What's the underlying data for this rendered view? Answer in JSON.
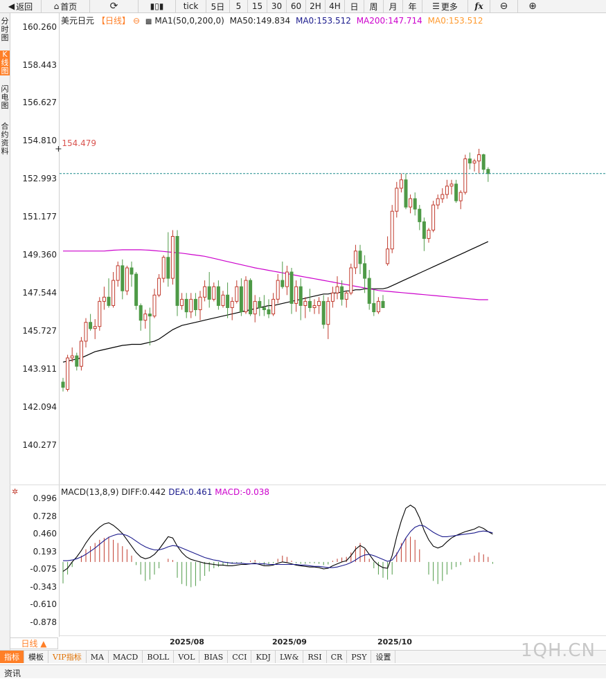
{
  "toolbar": {
    "back": "返回",
    "home": "首页",
    "tick": "tick",
    "periods": [
      "5日",
      "5",
      "15",
      "30",
      "60",
      "2H",
      "4H",
      "日",
      "周",
      "月",
      "年"
    ],
    "more": "更多",
    "fx": "fx"
  },
  "sidebar": {
    "items": [
      "分时图",
      "K线图",
      "闪电图",
      "合约资料"
    ],
    "active": "K线图"
  },
  "main_legend": {
    "symbol": "美元日元",
    "period": "【日线】",
    "ma_settings": "MA1(50,0,200,0)",
    "ma50": "MA50:149.834",
    "ma0a": "MA0:153.512",
    "ma200": "MA200:147.714",
    "ma0b": "MA0:153.512"
  },
  "macd_legend": {
    "name": "MACD(13,8,9)",
    "diff": "DIFF:0.442",
    "dea": "DEA:0.461",
    "macd": "MACD:-0.038"
  },
  "price_axis": [
    "160.260",
    "158.443",
    "156.627",
    "154.810",
    "152.993",
    "151.177",
    "149.360",
    "147.544",
    "145.727",
    "143.911",
    "142.094",
    "140.277"
  ],
  "macd_axis": [
    "0.996",
    "0.728",
    "0.460",
    "0.193",
    "-0.075",
    "-0.343",
    "-0.610",
    "-0.878"
  ],
  "date_labels": [
    "2025/08",
    "2025/09",
    "2025/10"
  ],
  "high_marker": "154.479",
  "period_tab": "日线 ▲",
  "indicator_tabs": [
    "指标",
    "模板",
    "VIP指标",
    "MA",
    "MACD",
    "BOLL",
    "VOL",
    "BIAS",
    "CCI",
    "KDJ",
    "LW&",
    "RSI",
    "CR",
    "PSY",
    "设置"
  ],
  "info_tab": "资讯",
  "watermark": "1QH.CN",
  "colors": {
    "up": "#c0392b",
    "down": "#4e9a47",
    "ma50": "#000000",
    "ma200": "#cc00cc",
    "diff": "#000000",
    "dea": "#1a1a8c",
    "accent": "#ff7f27",
    "current_line": "#1a8a8a"
  },
  "chart_data": [
    {
      "type": "candlestick",
      "title": "美元日元 日线",
      "ylim": [
        140.277,
        160.26
      ],
      "current_price": 153.3,
      "high_marker": 154.479,
      "ohlc": [
        [
          143.35,
          143.55,
          142.9,
          143.1
        ],
        [
          143.0,
          144.65,
          142.9,
          144.5
        ],
        [
          144.5,
          145.0,
          144.3,
          144.6
        ],
        [
          144.6,
          144.75,
          143.9,
          144.1
        ],
        [
          144.1,
          145.5,
          143.9,
          145.3
        ],
        [
          145.3,
          146.4,
          145.0,
          146.2
        ],
        [
          146.2,
          146.6,
          145.8,
          145.9
        ],
        [
          145.9,
          146.35,
          145.4,
          146.0
        ],
        [
          146.0,
          147.4,
          145.8,
          147.2
        ],
        [
          147.2,
          147.9,
          146.8,
          147.4
        ],
        [
          147.4,
          148.3,
          146.9,
          147.0
        ],
        [
          147.0,
          148.6,
          146.9,
          148.2
        ],
        [
          148.2,
          149.1,
          147.9,
          148.9
        ],
        [
          148.9,
          149.2,
          147.3,
          147.7
        ],
        [
          147.7,
          148.9,
          147.5,
          148.8
        ],
        [
          148.8,
          149.1,
          147.9,
          148.5
        ],
        [
          148.5,
          148.6,
          146.8,
          147.0
        ],
        [
          147.0,
          147.1,
          145.8,
          146.3
        ],
        [
          146.3,
          146.8,
          145.9,
          146.6
        ],
        [
          146.6,
          146.9,
          145.1,
          146.5
        ],
        [
          146.5,
          147.8,
          146.4,
          147.5
        ],
        [
          147.5,
          148.5,
          147.4,
          148.3
        ],
        [
          148.3,
          149.4,
          148.1,
          149.3
        ],
        [
          149.3,
          150.5,
          147.9,
          148.3
        ],
        [
          148.3,
          150.6,
          148.0,
          150.3
        ],
        [
          150.3,
          150.6,
          146.5,
          147.0
        ],
        [
          147.0,
          147.6,
          146.8,
          147.3
        ],
        [
          147.3,
          147.6,
          146.4,
          146.7
        ],
        [
          146.7,
          147.6,
          146.4,
          147.3
        ],
        [
          147.3,
          147.6,
          146.5,
          146.8
        ],
        [
          146.8,
          147.7,
          146.3,
          147.4
        ],
        [
          147.4,
          148.2,
          147.2,
          147.9
        ],
        [
          147.9,
          148.6,
          146.9,
          147.3
        ],
        [
          147.3,
          148.1,
          147.2,
          147.9
        ],
        [
          147.9,
          148.2,
          146.8,
          147.0
        ],
        [
          147.0,
          147.7,
          146.9,
          147.5
        ],
        [
          147.5,
          148.1,
          146.4,
          146.9
        ],
        [
          146.9,
          147.4,
          146.3,
          147.2
        ],
        [
          147.2,
          148.2,
          147.1,
          147.9
        ],
        [
          147.9,
          148.3,
          146.5,
          146.7
        ],
        [
          146.7,
          148.4,
          146.6,
          148.2
        ],
        [
          148.2,
          148.3,
          146.5,
          146.6
        ],
        [
          146.6,
          147.5,
          146.2,
          147.2
        ],
        [
          147.2,
          147.4,
          146.5,
          146.9
        ],
        [
          146.9,
          147.5,
          146.5,
          146.8
        ],
        [
          146.8,
          147.3,
          146.4,
          146.6
        ],
        [
          146.6,
          147.6,
          146.5,
          147.3
        ],
        [
          147.3,
          148.5,
          147.1,
          148.2
        ],
        [
          148.2,
          149.1,
          147.8,
          147.9
        ],
        [
          147.9,
          148.9,
          147.5,
          148.6
        ],
        [
          148.6,
          148.8,
          146.6,
          147.1
        ],
        [
          147.1,
          148.2,
          146.7,
          147.9
        ],
        [
          147.9,
          148.3,
          146.3,
          147.0
        ],
        [
          147.0,
          147.4,
          146.4,
          147.2
        ],
        [
          147.2,
          147.8,
          146.7,
          146.9
        ],
        [
          146.9,
          147.3,
          146.6,
          147.0
        ],
        [
          147.0,
          147.4,
          146.6,
          147.2
        ],
        [
          147.2,
          147.5,
          145.9,
          146.1
        ],
        [
          146.1,
          147.4,
          145.4,
          147.2
        ],
        [
          147.2,
          147.9,
          146.9,
          147.6
        ],
        [
          147.6,
          148.4,
          147.3,
          147.9
        ],
        [
          147.9,
          148.2,
          147.0,
          147.3
        ],
        [
          147.3,
          147.7,
          146.9,
          147.6
        ],
        [
          147.6,
          149.0,
          147.5,
          148.8
        ],
        [
          148.8,
          149.9,
          148.5,
          149.6
        ],
        [
          149.6,
          149.9,
          148.5,
          149.0
        ],
        [
          149.0,
          149.4,
          147.6,
          148.3
        ],
        [
          148.3,
          148.7,
          146.8,
          147.1
        ],
        [
          147.1,
          147.8,
          146.5,
          146.7
        ],
        [
          146.7,
          147.4,
          146.6,
          147.2
        ],
        [
          147.2,
          147.5,
          146.9,
          146.9
        ],
        [
          149.0,
          150.3,
          148.9,
          149.7
        ],
        [
          149.7,
          151.8,
          149.5,
          151.5
        ],
        [
          151.5,
          152.9,
          151.2,
          152.6
        ],
        [
          152.6,
          153.3,
          152.4,
          153.0
        ],
        [
          153.0,
          153.3,
          151.6,
          151.7
        ],
        [
          151.7,
          152.3,
          151.4,
          152.1
        ],
        [
          152.1,
          152.4,
          151.3,
          151.6
        ],
        [
          151.6,
          151.8,
          150.6,
          151.0
        ],
        [
          151.0,
          151.2,
          149.6,
          150.2
        ],
        [
          150.2,
          150.7,
          150.0,
          150.6
        ],
        [
          150.6,
          152.0,
          150.5,
          151.8
        ],
        [
          151.8,
          152.3,
          151.6,
          152.1
        ],
        [
          152.1,
          152.6,
          151.9,
          152.3
        ],
        [
          152.3,
          153.0,
          152.1,
          152.7
        ],
        [
          152.7,
          153.0,
          152.3,
          152.8
        ],
        [
          152.8,
          153.0,
          151.9,
          152.0
        ],
        [
          152.0,
          152.5,
          151.6,
          152.4
        ],
        [
          152.4,
          154.2,
          152.3,
          154.0
        ],
        [
          154.0,
          154.3,
          153.5,
          153.8
        ],
        [
          153.8,
          154.0,
          153.4,
          153.9
        ],
        [
          153.9,
          154.48,
          153.3,
          154.2
        ],
        [
          154.2,
          154.25,
          153.3,
          153.5
        ],
        [
          153.5,
          153.6,
          152.9,
          153.3
        ]
      ],
      "series": [
        {
          "name": "MA50",
          "values": [
            144.3,
            144.35,
            144.4,
            144.45,
            144.5,
            144.6,
            144.7,
            144.8,
            144.85,
            144.9,
            144.95,
            145.0,
            145.05,
            145.1,
            145.12,
            145.15,
            145.15,
            145.15,
            145.2,
            145.25,
            145.3,
            145.4,
            145.55,
            145.7,
            145.85,
            145.95,
            146.05,
            146.1,
            146.15,
            146.2,
            146.25,
            146.3,
            146.35,
            146.4,
            146.45,
            146.5,
            146.55,
            146.6,
            146.65,
            146.7,
            146.75,
            146.8,
            146.85,
            146.9,
            146.95,
            147.0,
            147.0,
            147.05,
            147.1,
            147.15,
            147.2,
            147.25,
            147.3,
            147.35,
            147.4,
            147.45,
            147.5,
            147.55,
            147.55,
            147.6,
            147.6,
            147.65,
            147.7,
            147.7,
            147.75,
            147.75,
            147.8,
            147.8,
            147.8,
            147.8,
            147.8,
            147.85,
            147.95,
            148.05,
            148.15,
            148.25,
            148.35,
            148.45,
            148.55,
            148.65,
            148.75,
            148.85,
            148.95,
            149.05,
            149.15,
            149.25,
            149.35,
            149.45,
            149.55,
            149.65,
            149.75,
            149.85,
            149.95,
            150.05
          ]
        },
        {
          "name": "MA200",
          "values": [
            149.6,
            149.6,
            149.6,
            149.6,
            149.6,
            149.6,
            149.6,
            149.6,
            149.6,
            149.6,
            149.62,
            149.64,
            149.65,
            149.66,
            149.66,
            149.66,
            149.66,
            149.66,
            149.65,
            149.64,
            149.62,
            149.6,
            149.58,
            149.56,
            149.54,
            149.52,
            149.5,
            149.47,
            149.44,
            149.41,
            149.38,
            149.35,
            149.3,
            149.25,
            149.2,
            149.15,
            149.1,
            149.05,
            149.0,
            148.95,
            148.9,
            148.85,
            148.8,
            148.76,
            148.72,
            148.68,
            148.64,
            148.6,
            148.56,
            148.52,
            148.48,
            148.44,
            148.4,
            148.36,
            148.32,
            148.28,
            148.24,
            148.2,
            148.16,
            148.12,
            148.08,
            148.04,
            148.0,
            147.96,
            147.92,
            147.88,
            147.84,
            147.8,
            147.76,
            147.72,
            147.7,
            147.68,
            147.66,
            147.64,
            147.62,
            147.6,
            147.58,
            147.56,
            147.54,
            147.52,
            147.5,
            147.48,
            147.46,
            147.44,
            147.42,
            147.4,
            147.38,
            147.36,
            147.34,
            147.32,
            147.3,
            147.28,
            147.28,
            147.28
          ]
        }
      ]
    },
    {
      "type": "bar",
      "title": "MACD(13,8,9)",
      "ylim": [
        -0.878,
        0.996
      ],
      "series": [
        {
          "name": "MACD",
          "values": [
            -0.34,
            -0.2,
            -0.08,
            0.0,
            0.1,
            0.2,
            0.25,
            0.3,
            0.35,
            0.38,
            0.4,
            0.35,
            0.3,
            0.25,
            0.2,
            0.1,
            -0.05,
            -0.2,
            -0.3,
            -0.28,
            -0.2,
            -0.1,
            0.0,
            0.05,
            0.03,
            -0.25,
            -0.35,
            -0.38,
            -0.4,
            -0.38,
            -0.3,
            -0.22,
            -0.15,
            -0.1,
            -0.08,
            -0.06,
            -0.05,
            -0.03,
            -0.02,
            -0.02,
            0.0,
            0.02,
            0.03,
            -0.01,
            -0.05,
            -0.04,
            -0.02,
            0.05,
            0.1,
            0.08,
            0.02,
            -0.02,
            -0.03,
            -0.03,
            -0.02,
            -0.02,
            -0.03,
            -0.05,
            -0.04,
            0.02,
            0.05,
            0.07,
            0.08,
            0.15,
            0.25,
            0.3,
            0.2,
            0.05,
            -0.1,
            -0.2,
            -0.25,
            -0.28,
            -0.2,
            0.15,
            0.3,
            0.38,
            0.4,
            0.35,
            0.2,
            0.0,
            -0.2,
            -0.3,
            -0.35,
            -0.3,
            -0.2,
            -0.12,
            -0.08,
            -0.05,
            0.0,
            0.05,
            0.1,
            0.15,
            0.12,
            0.08,
            -0.03
          ]
        },
        {
          "name": "DIFF",
          "values": [
            -0.15,
            -0.1,
            0.0,
            0.08,
            0.18,
            0.3,
            0.4,
            0.48,
            0.55,
            0.6,
            0.62,
            0.58,
            0.52,
            0.45,
            0.35,
            0.25,
            0.15,
            0.08,
            0.05,
            0.07,
            0.12,
            0.2,
            0.3,
            0.4,
            0.38,
            0.25,
            0.15,
            0.08,
            0.04,
            0.02,
            0.0,
            -0.02,
            -0.03,
            -0.04,
            -0.05,
            -0.05,
            -0.06,
            -0.06,
            -0.05,
            -0.04,
            -0.04,
            -0.03,
            -0.02,
            -0.04,
            -0.06,
            -0.06,
            -0.05,
            -0.02,
            0.0,
            -0.01,
            -0.03,
            -0.05,
            -0.06,
            -0.07,
            -0.08,
            -0.08,
            -0.09,
            -0.11,
            -0.1,
            -0.06,
            -0.03,
            0.0,
            0.02,
            0.1,
            0.2,
            0.26,
            0.22,
            0.12,
            0.02,
            -0.05,
            -0.09,
            -0.1,
            0.1,
            0.4,
            0.65,
            0.85,
            0.9,
            0.85,
            0.7,
            0.5,
            0.35,
            0.25,
            0.22,
            0.25,
            0.32,
            0.38,
            0.42,
            0.45,
            0.48,
            0.5,
            0.52,
            0.56,
            0.53,
            0.48,
            0.44
          ]
        },
        {
          "name": "DEA",
          "values": [
            0.02,
            0.02,
            0.03,
            0.05,
            0.08,
            0.12,
            0.17,
            0.22,
            0.28,
            0.34,
            0.39,
            0.42,
            0.44,
            0.44,
            0.42,
            0.38,
            0.33,
            0.28,
            0.24,
            0.21,
            0.19,
            0.19,
            0.21,
            0.24,
            0.26,
            0.25,
            0.22,
            0.19,
            0.16,
            0.13,
            0.1,
            0.07,
            0.05,
            0.03,
            0.02,
            0.0,
            -0.01,
            -0.02,
            -0.02,
            -0.02,
            -0.03,
            -0.03,
            -0.03,
            -0.03,
            -0.03,
            -0.04,
            -0.04,
            -0.04,
            -0.04,
            -0.04,
            -0.04,
            -0.04,
            -0.05,
            -0.05,
            -0.06,
            -0.07,
            -0.07,
            -0.08,
            -0.09,
            -0.09,
            -0.08,
            -0.06,
            -0.04,
            -0.01,
            0.03,
            0.08,
            0.11,
            0.12,
            0.1,
            0.07,
            0.04,
            0.01,
            0.03,
            0.12,
            0.25,
            0.38,
            0.48,
            0.55,
            0.58,
            0.57,
            0.52,
            0.47,
            0.43,
            0.4,
            0.4,
            0.41,
            0.42,
            0.43,
            0.44,
            0.45,
            0.46,
            0.48,
            0.49,
            0.48,
            0.46
          ]
        }
      ]
    }
  ]
}
